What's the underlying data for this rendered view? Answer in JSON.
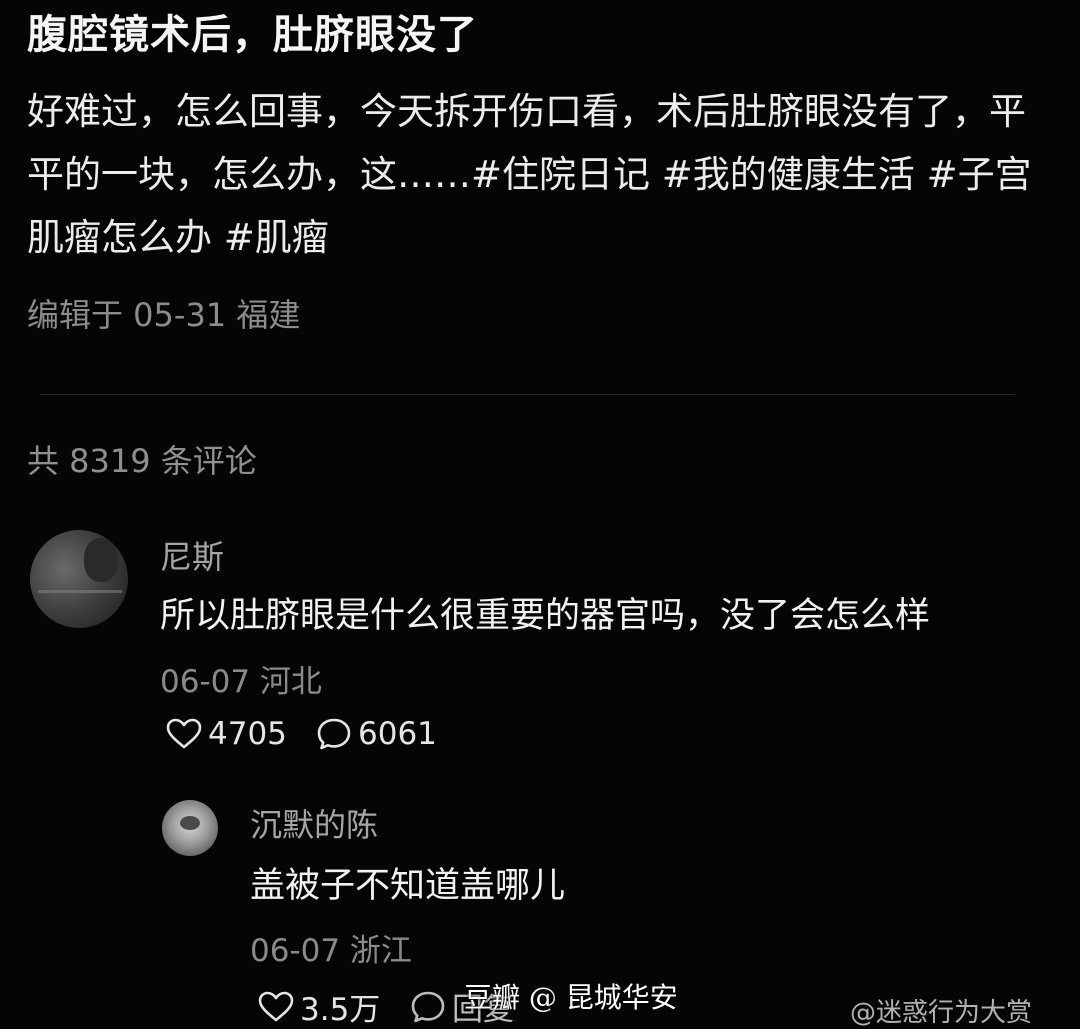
{
  "post": {
    "title": "腹腔镜术后，肚脐眼没了",
    "body": "好难过，怎么回事，今天拆开伤口看，术后肚脐眼没有了，平平的一块，怎么办，这……",
    "tags": [
      "#住院日记",
      "#我的健康生活",
      "#子宫肌瘤怎么办",
      "#肌瘤"
    ],
    "meta": "编辑于 05-31 福建"
  },
  "comments_header": {
    "count_text": "共 8319 条评论"
  },
  "comments": [
    {
      "name": "尼斯",
      "text": "所以肚脐眼是什么很重要的器官吗，没了会怎么样",
      "meta": "06-07 河北",
      "likes": "4705",
      "replies": "6061"
    },
    {
      "name": "沉默的陈",
      "text": "盖被子不知道盖哪儿",
      "meta": "06-07 浙江",
      "likes": "3.5万",
      "reply_label": "回复"
    }
  ],
  "watermark": {
    "text": "豆瓣 @ 昆城华安",
    "right_text": "@迷惑行为大赏"
  },
  "icons": {
    "like": "heart-outline-icon",
    "reply": "speech-bubble-icon"
  }
}
